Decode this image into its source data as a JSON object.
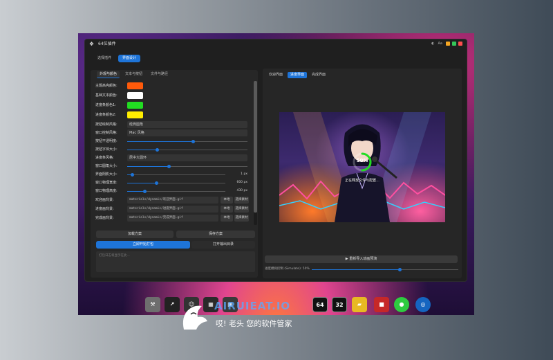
{
  "window": {
    "title": "64位插件",
    "theme_icon": "half-moon-icon",
    "lang_label": "Aa",
    "controls": [
      {
        "name": "minimize",
        "color": "#f5a623"
      },
      {
        "name": "maximize",
        "color": "#34c759"
      },
      {
        "name": "close",
        "color": "#ff4d4f"
      }
    ]
  },
  "main_tabs": [
    {
      "label": "选择插件",
      "active": false
    },
    {
      "label": "界面设计",
      "active": true
    }
  ],
  "left": {
    "subtabs": [
      {
        "label": "外观与颜色",
        "active": true
      },
      {
        "label": "文本与按钮",
        "active": false
      },
      {
        "label": "文件与路径",
        "active": false
      }
    ],
    "color_rows": [
      {
        "label": "主题高亮颜色:",
        "color": "#ff5a0a"
      },
      {
        "label": "基础文本颜色:",
        "color": "#ffffff"
      },
      {
        "label": "进度条颜色1:",
        "color": "#22dd22"
      },
      {
        "label": "进度条颜色2:",
        "color": "#ffee00"
      }
    ],
    "rows": [
      {
        "label": "按钮绘制风格:",
        "value": "经典圆角"
      },
      {
        "label": "窗口控制风格:",
        "value": "Mac 风格"
      },
      {
        "label": "按钮不透明度:",
        "level": 0.55
      },
      {
        "label": "按钮字体大小:",
        "level": 0.25
      },
      {
        "label": "进度条风格:",
        "value": "居中大圆环"
      },
      {
        "label": "窗口圆角大小:",
        "level": 0.35
      },
      {
        "label": "界面阴影大小:",
        "level": 0.05,
        "value": "1 px"
      },
      {
        "label": "窗口物理宽度:",
        "level": 0.3,
        "value": "600 px"
      },
      {
        "label": "窗口物理高度:",
        "level": 0.18,
        "value": "430 px"
      }
    ],
    "path_rows": [
      {
        "label": "欢迎画背景:",
        "path": "materials/dynamic/欢迎界面.gif",
        "btn1": "本地",
        "btn2": "选择素材"
      },
      {
        "label": "进度画背景:",
        "path": "materials/dynamic/进度界面.gif",
        "btn1": "本地",
        "btn2": "选择素材"
      },
      {
        "label": "完成画背景:",
        "path": "materials/dynamic/完成界面.gif",
        "btn1": "本地",
        "btn2": "选择素材"
      }
    ],
    "load_btn": "加载方案",
    "save_btn": "保存方案",
    "package_btn": "立即开始打包",
    "open_output_btn": "打开输出目录",
    "log_placeholder": "打包日志将显示在此..."
  },
  "right": {
    "tabs": [
      {
        "label": "欢迎界面",
        "active": false
      },
      {
        "label": "进度界面",
        "active": true
      },
      {
        "label": "完成界面",
        "active": false
      }
    ],
    "progress_text": "50%",
    "progress_level": 0.5,
    "caption": "正在释放文件与配置...",
    "import_btn": "重新导入动画预演",
    "speed_label": "进度模拟控制 (Simulate): 50%",
    "speed_level": 0.6
  },
  "watermark": {
    "brand": "AIRUIEAT.IO",
    "slogan": "哎! 老头 您的软件管家"
  },
  "dock": [
    {
      "icon": "toolbox-icon",
      "color": "#6e6e6e",
      "text": ""
    },
    {
      "icon": "arrow-tool-icon",
      "color": "#222222",
      "text": ""
    },
    {
      "icon": "anime-icon",
      "color": "#333333",
      "text": ""
    },
    {
      "icon": "film-icon",
      "color": "#2a2a2a",
      "text": ""
    },
    {
      "icon": "terminal-icon",
      "color": "#3a3a3a",
      "text": ""
    },
    {
      "icon": "badge-64-icon",
      "color": "#111111",
      "text": "64"
    },
    {
      "icon": "badge-32-icon",
      "color": "#111111",
      "text": "32"
    },
    {
      "icon": "folder-icon",
      "color": "#e8b923",
      "text": ""
    },
    {
      "icon": "media-icon",
      "color": "#c62828",
      "text": ""
    },
    {
      "icon": "wechat-icon",
      "color": "#2ecc40",
      "text": ""
    },
    {
      "icon": "circle-app-icon",
      "color": "#1565c0",
      "text": ""
    }
  ]
}
